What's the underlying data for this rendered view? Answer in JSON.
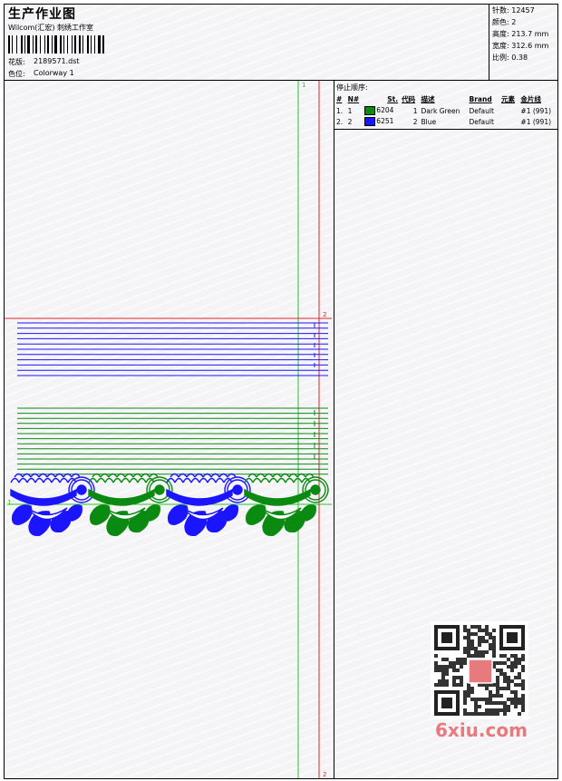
{
  "header": {
    "title": "生产作业图",
    "studio": "Wilcom(汇宏) 刺绣工作室",
    "design_label": "花版:",
    "design_file": "2189571.dst",
    "colorway_label": "色位:",
    "colorway": "Colorway 1"
  },
  "stats": [
    {
      "label": "针数:",
      "value": "12457"
    },
    {
      "label": "颜色:",
      "value": "2"
    },
    {
      "label": "高度:",
      "value": "213.7 mm"
    },
    {
      "label": "宽度:",
      "value": "312.6 mm"
    },
    {
      "label": "比例:",
      "value": "0.38"
    }
  ],
  "stop_sequence": {
    "heading": "停止顺序:",
    "columns": [
      "#",
      "N#",
      "St.",
      "代码",
      "描述",
      "Brand",
      "元素",
      "金片线"
    ],
    "rows": [
      {
        "index": "1.",
        "needle": "1",
        "color": "#0b8a12",
        "st": "6204",
        "code": "1",
        "description": "Dark Green",
        "brand": "Default",
        "element": "",
        "sequin": "#1 (991)"
      },
      {
        "index": "2.",
        "needle": "2",
        "color": "#1a14ff",
        "st": "6251",
        "code": "2",
        "description": "Blue",
        "brand": "Default",
        "element": "",
        "sequin": "#1 (991)"
      }
    ]
  },
  "markers": {
    "green_top": "1",
    "green_left": "1",
    "red_right": "2",
    "red_bottom": "2"
  },
  "colors": {
    "green": "#0b8a12",
    "blue": "#1a14ff",
    "guide_green": "#22c32a",
    "guide_red": "#e0242a",
    "watermark": "#e8797d"
  },
  "watermark": {
    "logo_text": "6xiu.com",
    "seal_text": "设计图库"
  }
}
